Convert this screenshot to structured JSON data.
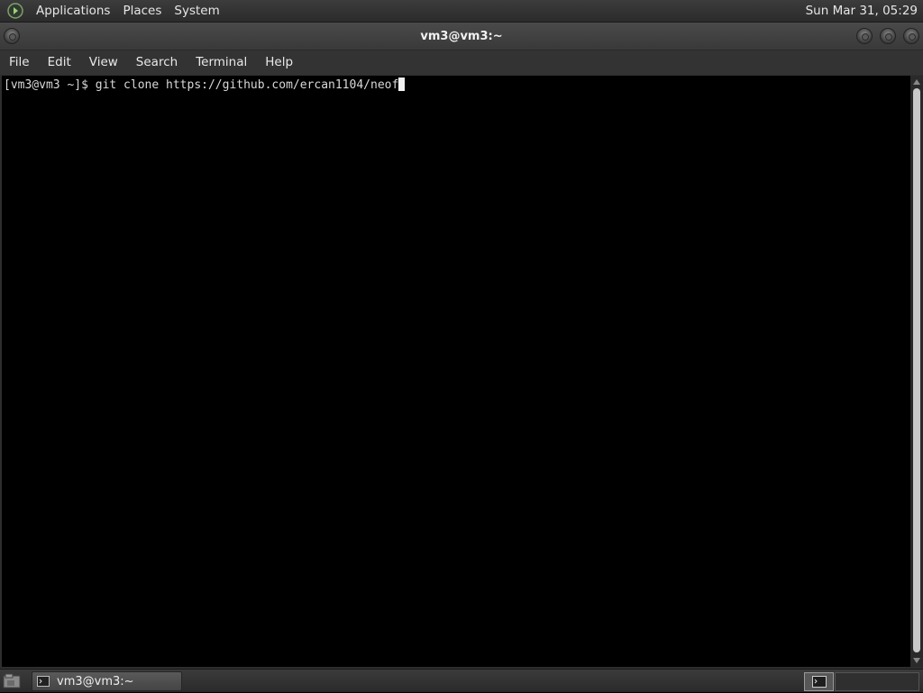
{
  "top_panel": {
    "menus": [
      "Applications",
      "Places",
      "System"
    ],
    "clock": "Sun Mar 31, 05:29"
  },
  "window": {
    "title": "vm3@vm3:~",
    "menubar": [
      "File",
      "Edit",
      "View",
      "Search",
      "Terminal",
      "Help"
    ]
  },
  "terminal": {
    "prompt": "[vm3@vm3 ~]$ ",
    "command": "git clone https://github.com/ercan1104/neof"
  },
  "taskbar": {
    "task_label": "vm3@vm3:~"
  }
}
